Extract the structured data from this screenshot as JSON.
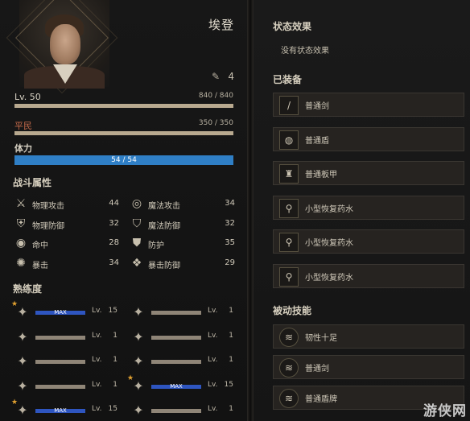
{
  "character": {
    "name": "埃登",
    "stat_points": "4",
    "level_label": "Lv. 50",
    "xp_value": "840 / 840",
    "xp_fraction": 1.0,
    "class_label": "平民",
    "class_value": "350 / 350",
    "class_fraction": 1.0,
    "stamina_label": "体力",
    "stamina_value": "54 / 54",
    "stamina_fraction": 1.0
  },
  "combat": {
    "title": "战斗属性",
    "attributes": [
      {
        "icon": "sword-cross-icon",
        "label": "物理攻击",
        "value": "44"
      },
      {
        "icon": "magic-swirl-icon",
        "label": "魔法攻击",
        "value": "34"
      },
      {
        "icon": "shield-cross-icon",
        "label": "物理防御",
        "value": "32"
      },
      {
        "icon": "magic-shield-icon",
        "label": "魔法防御",
        "value": "32"
      },
      {
        "icon": "target-icon",
        "label": "命中",
        "value": "28"
      },
      {
        "icon": "guard-icon",
        "label": "防护",
        "value": "35"
      },
      {
        "icon": "burst-icon",
        "label": "暴击",
        "value": "34"
      },
      {
        "icon": "crit-shield-icon",
        "label": "暴击防御",
        "value": "29"
      }
    ]
  },
  "proficiency": {
    "title": "熟练度",
    "lv_label": "Lv.",
    "max_label": "MAX",
    "items": [
      {
        "icon": "weapon-class-icon",
        "starred": true,
        "max": true,
        "level": "15"
      },
      {
        "icon": "weapon-class-icon",
        "starred": false,
        "max": false,
        "level": "1"
      },
      {
        "icon": "weapon-class-icon",
        "starred": false,
        "max": false,
        "level": "1"
      },
      {
        "icon": "weapon-class-icon",
        "starred": false,
        "max": false,
        "level": "1"
      },
      {
        "icon": "weapon-class-icon",
        "starred": false,
        "max": false,
        "level": "1"
      },
      {
        "icon": "weapon-class-icon",
        "starred": false,
        "max": false,
        "level": "1"
      },
      {
        "icon": "weapon-class-icon",
        "starred": false,
        "max": false,
        "level": "1"
      },
      {
        "icon": "weapon-class-icon",
        "starred": true,
        "max": true,
        "level": "15"
      },
      {
        "icon": "weapon-class-icon",
        "starred": true,
        "max": true,
        "level": "15"
      },
      {
        "icon": "weapon-class-icon",
        "starred": false,
        "max": false,
        "level": "1"
      }
    ]
  },
  "status": {
    "title": "状态效果",
    "empty_note": "没有状态效果"
  },
  "equipment": {
    "title": "已装备",
    "items": [
      {
        "icon": "sword-icon",
        "label": "普通剑"
      },
      {
        "icon": "round-shield-icon",
        "label": "普通盾"
      },
      {
        "icon": "plate-armor-icon",
        "label": "普通板甲"
      },
      {
        "icon": "potion-icon",
        "label": "小型恢复药水"
      },
      {
        "icon": "potion-icon",
        "label": "小型恢复药水"
      },
      {
        "icon": "potion-icon",
        "label": "小型恢复药水"
      }
    ]
  },
  "passive": {
    "title": "被动技能",
    "items": [
      {
        "icon": "passive-skill-icon",
        "label": "韧性十足"
      },
      {
        "icon": "passive-skill-icon",
        "label": "普通剑"
      },
      {
        "icon": "passive-skill-icon",
        "label": "普通盾牌"
      }
    ]
  },
  "watermark": "游侠网",
  "colors": {
    "accent_blue": "#2f7fc6",
    "max_bar_blue": "#2e55c0",
    "star_gold": "#e0a030",
    "class_red": "#c46a4a"
  }
}
